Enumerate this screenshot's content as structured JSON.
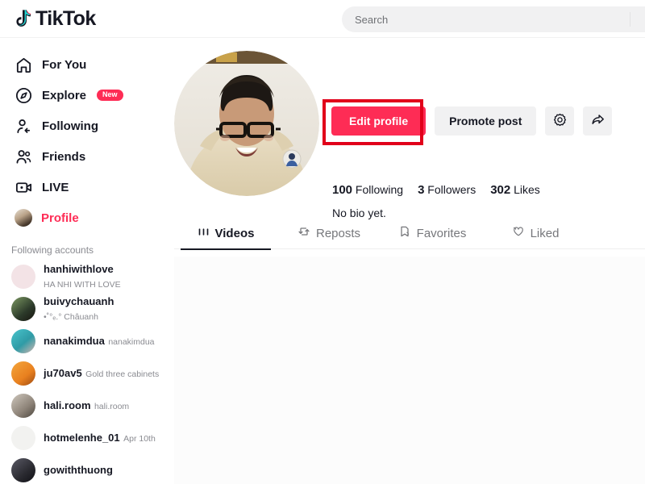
{
  "header": {
    "logo_text": "TikTok",
    "logo_icon": "tiktok-note-icon",
    "search": {
      "placeholder": "Search",
      "value": "",
      "icon": "search-icon"
    }
  },
  "sidebar": {
    "nav": [
      {
        "label": "For You",
        "icon": "home-icon",
        "active": false,
        "badge": ""
      },
      {
        "label": "Explore",
        "icon": "compass-icon",
        "active": false,
        "badge": "New"
      },
      {
        "label": "Following",
        "icon": "user-arrow-icon",
        "active": false,
        "badge": ""
      },
      {
        "label": "Friends",
        "icon": "users-icon",
        "active": false,
        "badge": ""
      },
      {
        "label": "LIVE",
        "icon": "live-video-icon",
        "active": false,
        "badge": ""
      },
      {
        "label": "Profile",
        "icon": "avatar-icon",
        "active": true,
        "badge": ""
      }
    ],
    "section_title": "Following accounts",
    "accounts": [
      {
        "name": "hanhiwithlove",
        "subtitle": "HA NHI WITH LOVE",
        "avatar_color": "#f3e3e6"
      },
      {
        "name": "buivychauanh",
        "subtitle": "•˚°ₑ.° Châuanh",
        "avatar_color": "#3f5a3a"
      },
      {
        "name": "nanakimdua",
        "subtitle": "nanakimdua",
        "avatar_color": "#2f9ba6"
      },
      {
        "name": "ju70av5",
        "subtitle": "Gold three cabinets",
        "avatar_color": "#e8801f"
      },
      {
        "name": "hali.room",
        "subtitle": "hali.room",
        "avatar_color": "#8d8378"
      },
      {
        "name": "hotmelenhe_01",
        "subtitle": "Apr 10th",
        "avatar_color": "#f2f2f0"
      },
      {
        "name": "gowiththuong",
        "subtitle": "",
        "avatar_color": "#2a2a30"
      }
    ]
  },
  "profile": {
    "avatar_name": "profile-avatar",
    "buttons": {
      "edit": "Edit profile",
      "promote": "Promote post",
      "settings_icon": "gear-icon",
      "share_icon": "share-arrow-icon"
    },
    "stats": [
      {
        "count": "100",
        "label": "Following"
      },
      {
        "count": "3",
        "label": "Followers"
      },
      {
        "count": "302",
        "label": "Likes"
      }
    ],
    "bio": "No bio yet."
  },
  "tabs": [
    {
      "label": "Videos",
      "icon": "grid-bars-icon",
      "active": true
    },
    {
      "label": "Reposts",
      "icon": "repost-icon",
      "active": false
    },
    {
      "label": "Favorites",
      "icon": "bookmark-icon",
      "active": false
    },
    {
      "label": "Liked",
      "icon": "heart-lock-icon",
      "active": false
    }
  ],
  "annotation": {
    "target": "Edit profile",
    "color": "#e1001a"
  },
  "colors": {
    "accent": "#fe2c55",
    "text": "#161823",
    "muted": "#8a8b91",
    "chip": "#f1f1f2"
  }
}
